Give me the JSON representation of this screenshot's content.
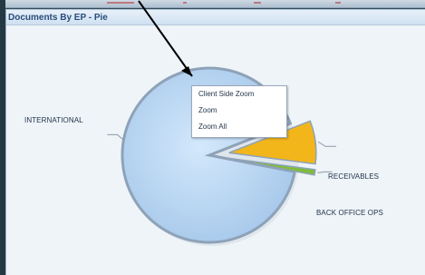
{
  "panel": {
    "title": "Documents By EP - Pie"
  },
  "chart_data": {
    "type": "pie",
    "series": [
      {
        "values": [
          91,
          8,
          1
        ]
      }
    ],
    "slice_labels": [
      "INTERNATIONAL",
      "BACK OFFICE OPS",
      "RECEIVABLES"
    ],
    "colors": {
      "international": "#bcd8f4",
      "back_office_ops": "#f2b61b",
      "receivables": "#7fbc39",
      "outline": "#8ea2b8"
    }
  },
  "context_menu": {
    "items": [
      "Client Side Zoom",
      "Zoom",
      "Zoom All"
    ]
  },
  "colors": {
    "background": "#2f4a58",
    "panel_background": "#eef4f8",
    "header_text": "#294d7a",
    "arrow": "#000000"
  }
}
